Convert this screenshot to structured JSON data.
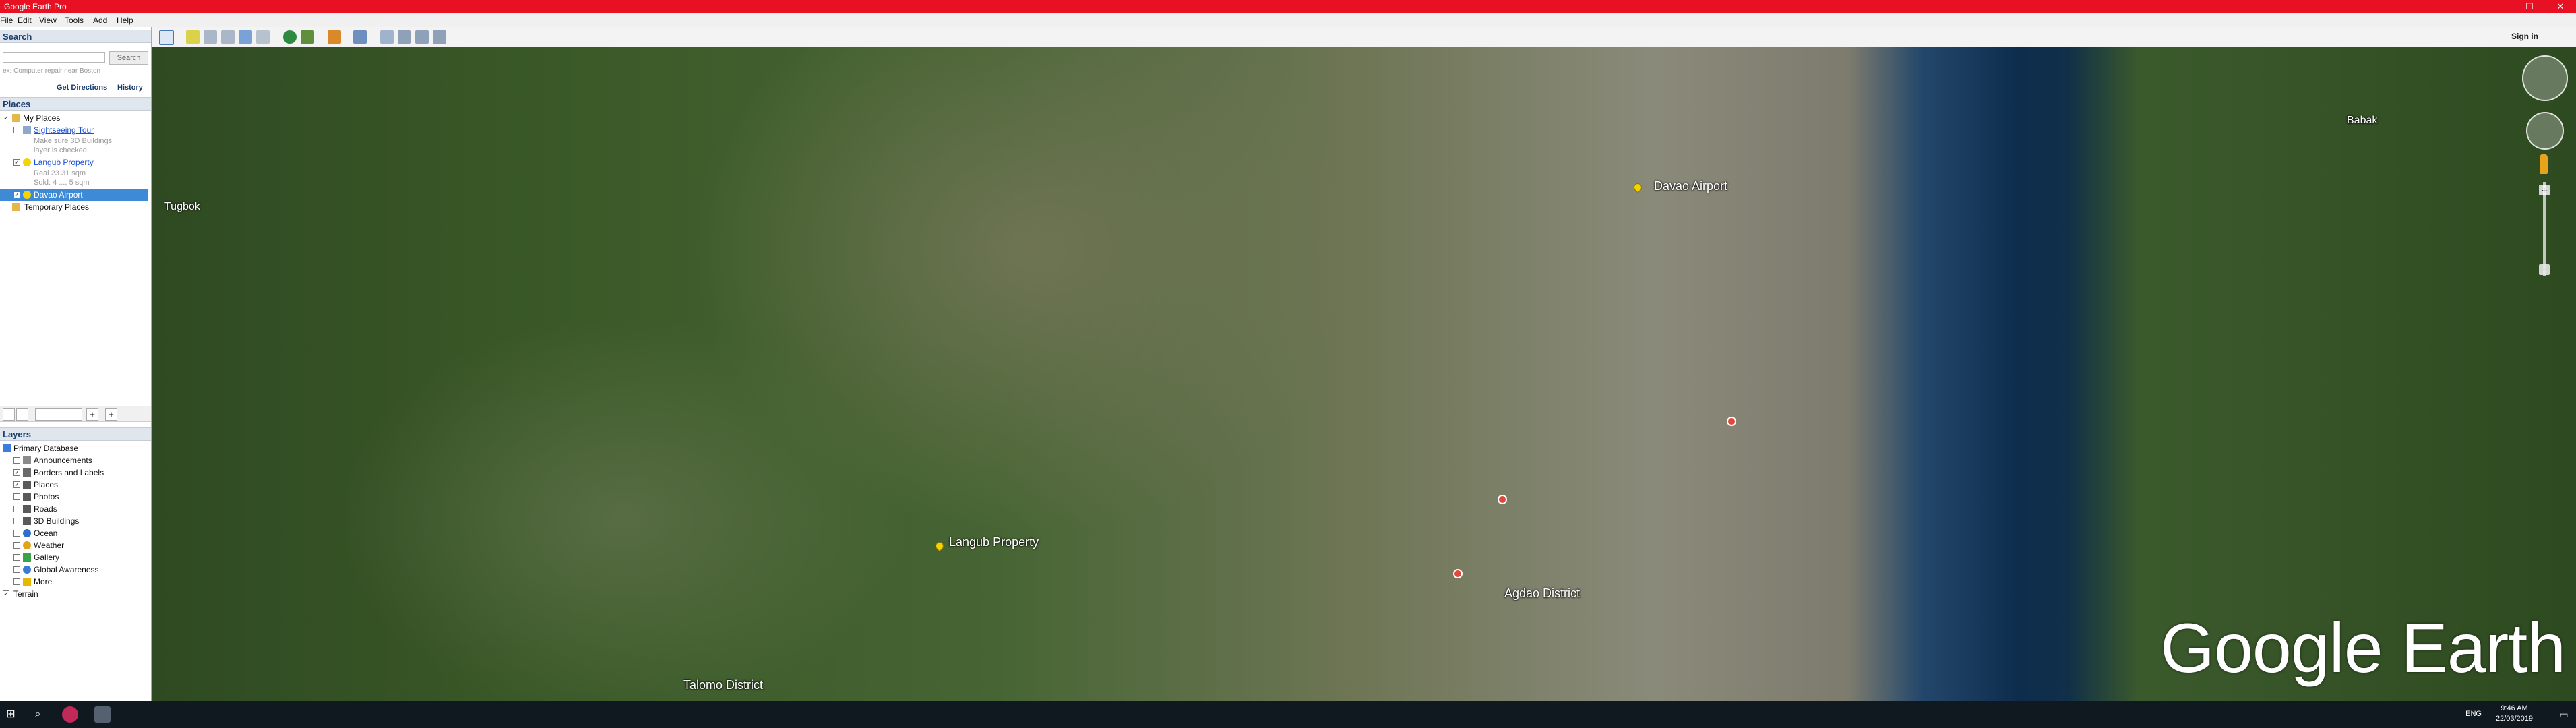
{
  "window": {
    "title": "Google Earth Pro"
  },
  "menu": [
    "File",
    "Edit",
    "View",
    "Tools",
    "Add",
    "Help"
  ],
  "toolbar": {
    "sign_in": "Sign in"
  },
  "search": {
    "header": "Search",
    "placeholder": "",
    "button": "Search",
    "hint": "ex: Computer repair near Boston",
    "get_directions": "Get Directions",
    "history": "History"
  },
  "places": {
    "header": "Places",
    "items": [
      {
        "label": "My Places",
        "type": "folder"
      },
      {
        "label": "Sightseeing Tour",
        "type": "tour",
        "link": true
      },
      {
        "label": "Make sure 3D Buildings",
        "type": "note"
      },
      {
        "label": "layer is checked",
        "type": "note"
      },
      {
        "label": "Langub Property",
        "type": "placemark",
        "link": true
      },
      {
        "label": "Real 23.31 sqm",
        "type": "note"
      },
      {
        "label": "Sold: 4 ..., 5 sqm",
        "type": "note"
      },
      {
        "label": "Davao Airport",
        "type": "placemark",
        "selected": true
      },
      {
        "label": "Temporary Places",
        "type": "folder"
      }
    ]
  },
  "layers": {
    "header": "Layers",
    "items": [
      {
        "label": "Primary Database",
        "color": "#3b7dd8"
      },
      {
        "label": "Announcements",
        "color": "#8a8a8a"
      },
      {
        "label": "Borders and Labels",
        "color": "#6a6a6a"
      },
      {
        "label": "Places",
        "color": "#5a5a5a"
      },
      {
        "label": "Photos",
        "color": "#5a5a5a"
      },
      {
        "label": "Roads",
        "color": "#5a5a5a"
      },
      {
        "label": "3D Buildings",
        "color": "#5a5a5a"
      },
      {
        "label": "Ocean",
        "color": "#2e6fc7"
      },
      {
        "label": "Weather",
        "color": "#e3a21a"
      },
      {
        "label": "Gallery",
        "color": "#3aa34a"
      },
      {
        "label": "Global Awareness",
        "color": "#3a7bd5"
      },
      {
        "label": "More",
        "color": "#e6b800"
      },
      {
        "label": "Terrain",
        "color": "#666"
      }
    ]
  },
  "map": {
    "labels": {
      "davao_airport": "Davao Airport",
      "langub_property": "Langub Property",
      "tugbok": "Tugbok",
      "babak": "Babak",
      "agdao": "Agdao District",
      "talomo": "Talomo District"
    },
    "logo": "Google Earth"
  },
  "taskbar": {
    "lang": "ENG",
    "time": "9:46 AM",
    "date": "22/03/2019"
  }
}
